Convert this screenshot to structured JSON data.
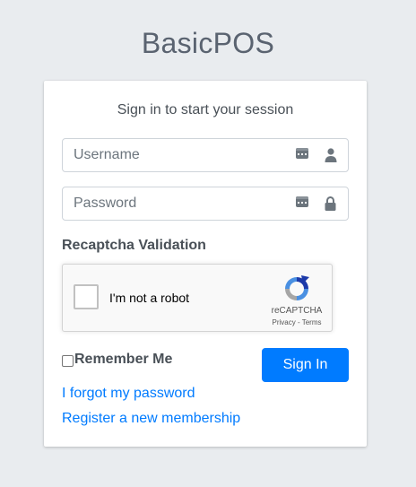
{
  "brand": {
    "bold": "Basic",
    "light": "POS"
  },
  "login": {
    "message": "Sign in to start your session",
    "username": {
      "placeholder": "Username",
      "value": ""
    },
    "password": {
      "placeholder": "Password",
      "value": ""
    },
    "recaptcha_label": "Recaptcha Validation",
    "recaptcha": {
      "checkbox_text": "I'm not a robot",
      "brand": "reCAPTCHA",
      "links": "Privacy - Terms",
      "checked": false
    },
    "remember_label": "Remember Me",
    "remember_checked": false,
    "signin_label": "Sign In",
    "forgot_link": "I forgot my password",
    "register_link": "Register a new membership"
  },
  "colors": {
    "primary": "#007bff",
    "background": "#e9ecef",
    "text": "#495057"
  },
  "icons": {
    "username": "user-icon",
    "password": "lock-icon",
    "autofill": "keyboard-icon"
  }
}
